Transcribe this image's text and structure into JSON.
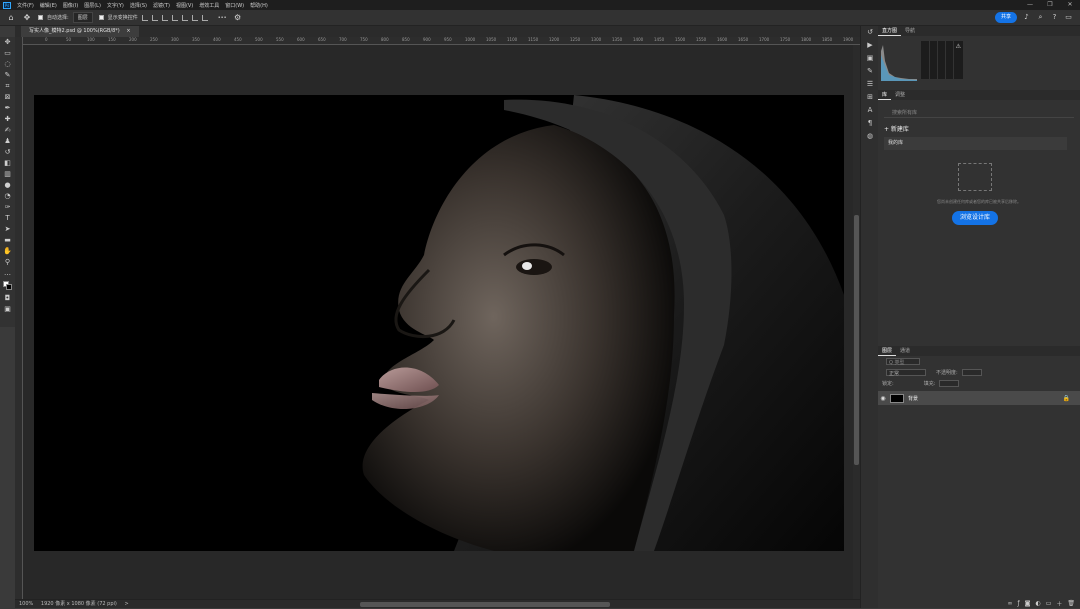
{
  "menubar": {
    "logo": "Ps",
    "items": [
      "文件(F)",
      "编辑(E)",
      "图像(I)",
      "图层(L)",
      "文字(Y)",
      "选择(S)",
      "滤镜(T)",
      "视图(V)",
      "增效工具",
      "窗口(W)",
      "帮助(H)"
    ],
    "window_controls": [
      "—",
      "❐",
      "✕"
    ]
  },
  "options": {
    "auto_select_label": "自动选择:",
    "auto_select_value": "图层",
    "transform_label": "显示变换控件",
    "more": "•••",
    "share_label": "共享"
  },
  "document": {
    "tab_title": "写实人像_模特2.psd @ 100%(RGB/8*)",
    "tab_close": "×",
    "ruler_ticks": [
      "0",
      "50",
      "100",
      "150",
      "200",
      "250",
      "300",
      "350",
      "400",
      "450",
      "500",
      "550",
      "600",
      "650",
      "700",
      "750",
      "800",
      "850",
      "900",
      "950",
      "1000",
      "1050",
      "1100",
      "1150",
      "1200",
      "1250",
      "1300",
      "1350",
      "1400",
      "1450",
      "1500",
      "1550",
      "1600",
      "1650",
      "1700",
      "1750",
      "1800",
      "1850",
      "1900"
    ]
  },
  "status": {
    "zoom": "100%",
    "info": "1920 像素 x 1080 像素 (72 ppi)",
    "arrow": ">"
  },
  "panels": {
    "histogram_tabs": [
      "直方图",
      "导航"
    ],
    "library_tabs": [
      "库",
      "调整"
    ],
    "library_search_placeholder": "搜索所有库",
    "new_library": "+ 新建库",
    "my_library": "我的库",
    "empty_hint": "您尚未创建任何库或者您的库已被共享后移除。",
    "browse_button": "浏览设计库",
    "layer_tabs": [
      "图层",
      "通道"
    ],
    "filter_label": "Q 类型",
    "blend_mode": "正常",
    "opacity_label": "不透明度:",
    "lock_label": "锁定:",
    "fill_label": "填充:",
    "layer_name": "背景"
  },
  "colors": {
    "accent": "#1473e6",
    "app_bg": "#3a3a3a",
    "panel_bg": "#323232"
  }
}
